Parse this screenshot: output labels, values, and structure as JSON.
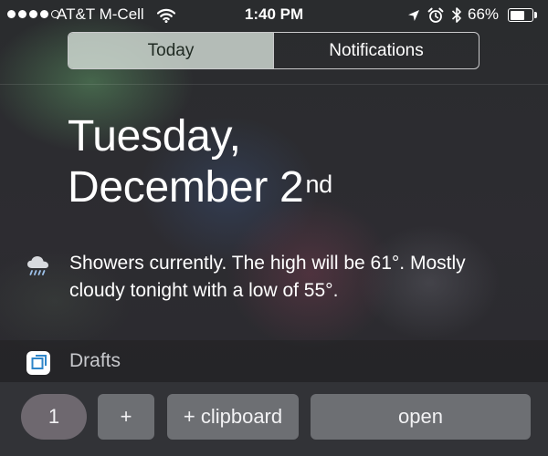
{
  "status_bar": {
    "carrier": "AT&T M-Cell",
    "time": "1:40 PM",
    "battery_percent": "66%",
    "battery_level": 0.66,
    "signal_bars_filled": 4,
    "signal_bars_total": 5,
    "icons": [
      "wifi-icon",
      "location-arrow-icon",
      "alarm-clock-icon",
      "bluetooth-icon",
      "battery-icon"
    ]
  },
  "segmented": {
    "today_label": "Today",
    "notifications_label": "Notifications",
    "selected": "Today"
  },
  "today": {
    "weekday": "Tuesday,",
    "date": "December 2",
    "date_suffix": "nd",
    "weather_icon": "rain-cloud-icon",
    "weather_line1": "Showers currently. The high will be 61°. Mostly",
    "weather_line2": "cloudy tonight with a low of 55°."
  },
  "drafts_widget": {
    "app_icon": "drafts-app-icon",
    "title": "Drafts",
    "count_label": "1",
    "add_label": "+",
    "clipboard_label": "+ clipboard",
    "open_label": "open"
  },
  "colors": {
    "segment_selected_bg": "#d7e1da",
    "segment_border": "#c9c9cb",
    "drafts_icon_blue": "#2f86c9",
    "text": "#ffffff"
  }
}
